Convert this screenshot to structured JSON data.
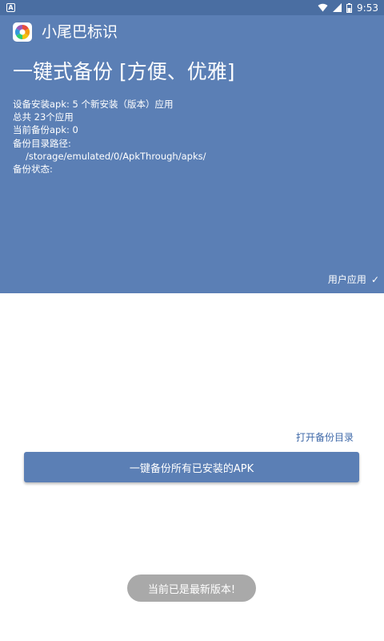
{
  "status_bar": {
    "notification": "A",
    "time": "9:53"
  },
  "app": {
    "title": "小尾巴标识"
  },
  "header": {
    "main_title": "一键式备份 [方便、优雅]",
    "info_lines": [
      "设备安装apk: 5 个新安装（版本）应用",
      "总共 23个应用",
      "当前备份apk: 0",
      "备份目录路径:",
      "/storage/emulated/0/ApkThrough/apks/",
      "备份状态:"
    ],
    "filter_label": "用户应用",
    "filter_check": "✓"
  },
  "actions": {
    "open_dir": "打开备份目录",
    "backup_all": "一键备份所有已安装的APK"
  },
  "toast": {
    "message": "当前已是最新版本!"
  },
  "colors": {
    "primary": "#5b7fb5",
    "status_bar": "#4a6ea2",
    "link": "#3e68a8",
    "toast_bg": "#a9a9a9"
  }
}
